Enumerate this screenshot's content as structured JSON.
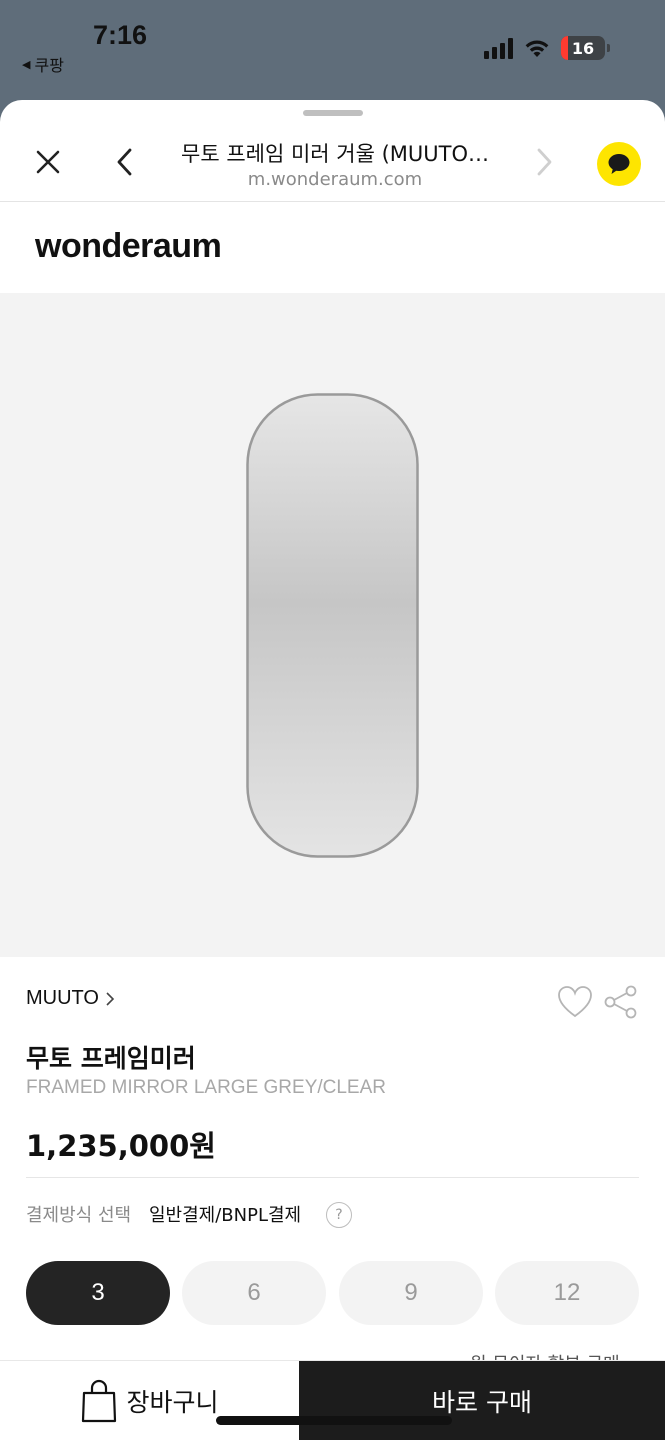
{
  "status_bar": {
    "time": "7:16",
    "back_app": "쿠팡",
    "battery": "16"
  },
  "nav": {
    "title": "무토 프레임 미러 거울 (MUUTO…",
    "url": "m.wonderaum.com"
  },
  "brand_logo": "wonderaum",
  "product": {
    "brand": "MUUTO",
    "name": "무토 프레임미러",
    "subtitle": "FRAMED MIRROR LARGE GREY/CLEAR",
    "price": "1,235,000원",
    "payment_label": "결제방식 선택",
    "payment_value": "일반결제/BNPL결제",
    "help_label": "?",
    "installments": [
      "3",
      "6",
      "9",
      "12"
    ],
    "selected_installment": "3"
  },
  "bottom": {
    "partial_text": "원 무이자 할부 구매",
    "cart_label": "장바구니",
    "buy_label": "바로 구매"
  },
  "colors": {
    "sheet": "#ffffff",
    "dim_background": "#5f6d7a",
    "kakao": "#fee500",
    "dark_button": "#1c1c1c"
  }
}
